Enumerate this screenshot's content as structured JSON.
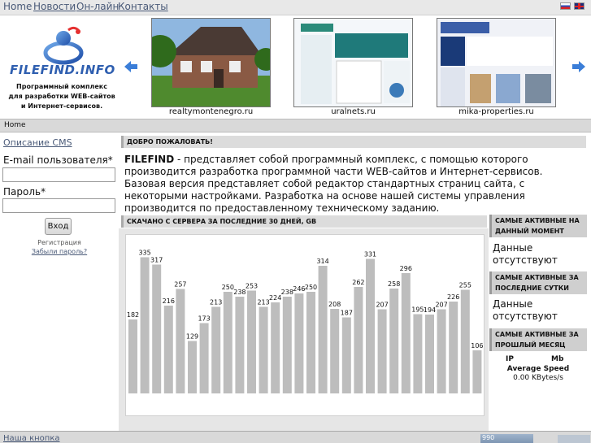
{
  "nav": {
    "items": [
      "Home",
      "Новости",
      "Он-лайн",
      "Контакты"
    ],
    "colors": {
      "link": "#4a5a78",
      "bar": "#e8e8e8"
    }
  },
  "header": {
    "logo": "FILEFIND.INFO",
    "tagline": "Программный комплекс для разработки WEB-сайтов и Интернет-сервисов.",
    "thumbs": [
      {
        "caption": "realtymontenegro.ru"
      },
      {
        "caption": "uralnets.ru"
      },
      {
        "caption": "mika-properties.ru"
      }
    ]
  },
  "breadcrumb": "Home",
  "left": {
    "cms_link": "Описание CMS",
    "email_label": "E-mail пользователя*",
    "password_label": "Пароль*",
    "login_button": "Вход",
    "register": "Регистрация",
    "forgot": "Забыли пароль?"
  },
  "welcome": {
    "title": "ДОБРО ПОЖАЛОВАТЬ!",
    "brand": "FILEFIND",
    "text": " - представляет собой программный комплекс, с помощью которого производится разработка программной части WEB-сайтов и Интернет-сервисов. Базовая версия представляет собой редактор стандартных страниц сайта, с некоторыми настройками. Разработка на основе нашей системы управления производится по предоставленному техническому заданию."
  },
  "chart_section": {
    "title": "СКАЧАНО С СЕРВЕРА ЗА ПОСЛЕДНИЕ 30 ДНЕЙ, GB"
  },
  "chart_data": {
    "type": "bar",
    "values": [
      182,
      335,
      317,
      216,
      257,
      129,
      173,
      213,
      250,
      238,
      253,
      213,
      224,
      238,
      246,
      250,
      314,
      208,
      187,
      262,
      331,
      207,
      258,
      296,
      195,
      194,
      207,
      226,
      255,
      106
    ],
    "ylim": [
      0,
      350
    ],
    "bar_color": "#bdbdbd",
    "grid": false
  },
  "side": {
    "now_title": "САМЫЕ АКТИВНЫЕ НА ДАННЫЙ МОМЕНТ",
    "now_text": "Данные отсутствуют",
    "day_title": "САМЫЕ АКТИВНЫЕ ЗА ПОСЛЕДНИЕ СУТКИ",
    "day_text": "Данные отсутствуют",
    "month_title": "САМЫЕ АКТИВНЫЕ ЗА ПРОШЛЫЙ МЕСЯЦ",
    "ip_label": "IP",
    "mb_label": "Mb",
    "speed_label": "Average Speed",
    "speed_value": "0.00 KBytes/s"
  },
  "footer": {
    "link": "Наша кнопка",
    "counter": "990"
  }
}
